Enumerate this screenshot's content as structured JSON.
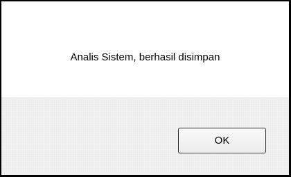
{
  "dialog": {
    "message": "Analis Sistem, berhasil disimpan",
    "ok_label": "OK"
  }
}
